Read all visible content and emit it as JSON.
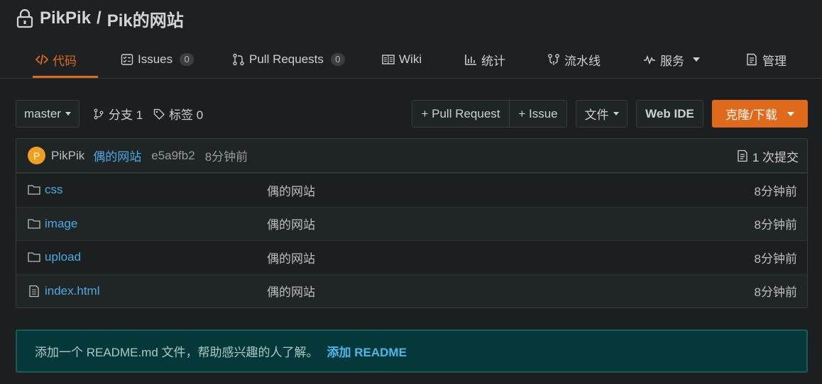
{
  "repo": {
    "owner": "PikPik",
    "separator": "/",
    "name": "Pik的网站"
  },
  "tabs": [
    {
      "label": "代码",
      "icon": "code-icon"
    },
    {
      "label": "Issues",
      "count": "0",
      "icon": "issues-icon"
    },
    {
      "label": "Pull Requests",
      "count": "0",
      "icon": "pull-request-icon"
    },
    {
      "label": "Wiki",
      "icon": "wiki-icon"
    },
    {
      "label": "统计",
      "icon": "chart-icon"
    },
    {
      "label": "流水线",
      "icon": "pipeline-icon"
    },
    {
      "label": "服务",
      "icon": "pulse-icon"
    },
    {
      "label": "管理",
      "icon": "manage-icon"
    }
  ],
  "toolbar": {
    "branch": "master",
    "branches": "分支 1",
    "tags": "标签 0",
    "pull_request": "+ Pull Request",
    "issue": "+ Issue",
    "file": "文件",
    "web_ide": "Web IDE",
    "clone": "克隆/下载"
  },
  "commit": {
    "avatar_letter": "P",
    "author": "PikPik",
    "message": "偶的网站",
    "hash": "e5a9fb2",
    "time": "8分钟前",
    "count": "1 次提交"
  },
  "files": [
    {
      "name": "css",
      "type": "folder",
      "message": "偶的网站",
      "time": "8分钟前"
    },
    {
      "name": "image",
      "type": "folder",
      "message": "偶的网站",
      "time": "8分钟前"
    },
    {
      "name": "upload",
      "type": "folder",
      "message": "偶的网站",
      "time": "8分钟前"
    },
    {
      "name": "index.html",
      "type": "file",
      "message": "偶的网站",
      "time": "8分钟前"
    }
  ],
  "readme": {
    "text": "添加一个 README.md 文件，帮助感兴趣的人了解。",
    "link": "添加 README"
  },
  "colors": {
    "accent": "#e06a1b",
    "link": "#4da9e6",
    "background": "#1b1f20",
    "readme_bg": "#053838"
  }
}
